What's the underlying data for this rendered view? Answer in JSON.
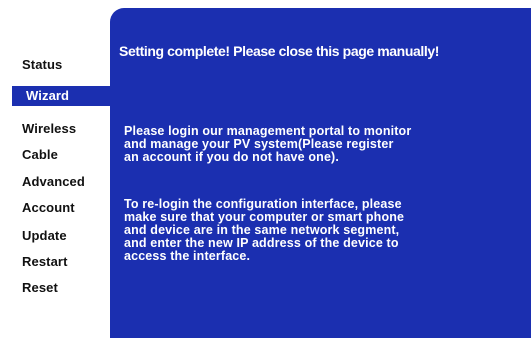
{
  "sidebar": {
    "items": [
      {
        "label": "Status"
      },
      {
        "label": "Wizard"
      },
      {
        "label": "Wireless"
      },
      {
        "label": "Cable"
      },
      {
        "label": "Advanced"
      },
      {
        "label": "Account"
      },
      {
        "label": "Update"
      },
      {
        "label": "Restart"
      },
      {
        "label": "Reset"
      }
    ],
    "active_item": "Wizard"
  },
  "panel": {
    "title": "Setting complete! Please close this page manually!",
    "paragraph_1": "Please login our management portal to monitor\nand manage your PV system(Please register\nan account if you do not have one).",
    "paragraph_2": "To re-login the configuration interface, please\nmake sure that your computer or smart phone\nand device are in the same network segment,\nand enter the new IP address of the device to\naccess the interface."
  },
  "colors": {
    "accent": "#1b2fb0",
    "text_dark": "#111111",
    "text_light": "#ffffff"
  }
}
